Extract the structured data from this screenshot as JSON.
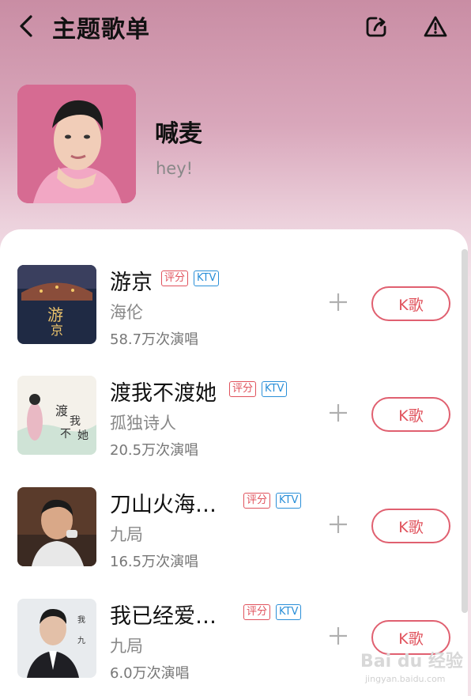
{
  "header": {
    "title": "主题歌单"
  },
  "playlist": {
    "name": "喊麦",
    "description": "hey!"
  },
  "tags": {
    "score": "评分",
    "ktv": "KTV"
  },
  "sing_label": "K歌",
  "songs": [
    {
      "title": "游京",
      "artist": "海伦",
      "plays": "58.7万次演唱"
    },
    {
      "title": "渡我不渡她",
      "artist": "孤独诗人",
      "plays": "20.5万次演唱"
    },
    {
      "title": "刀山火海…",
      "artist": "九局",
      "plays": "16.5万次演唱"
    },
    {
      "title": "我已经爱…",
      "artist": "九局",
      "plays": "6.0万次演唱"
    }
  ],
  "watermark": {
    "main": "Bai du 经验",
    "sub": "jingyan.baidu.com"
  },
  "colors": {
    "accent": "#e0525c",
    "ktv": "#2a8fd8",
    "header_bg": "#d9a7bb"
  }
}
